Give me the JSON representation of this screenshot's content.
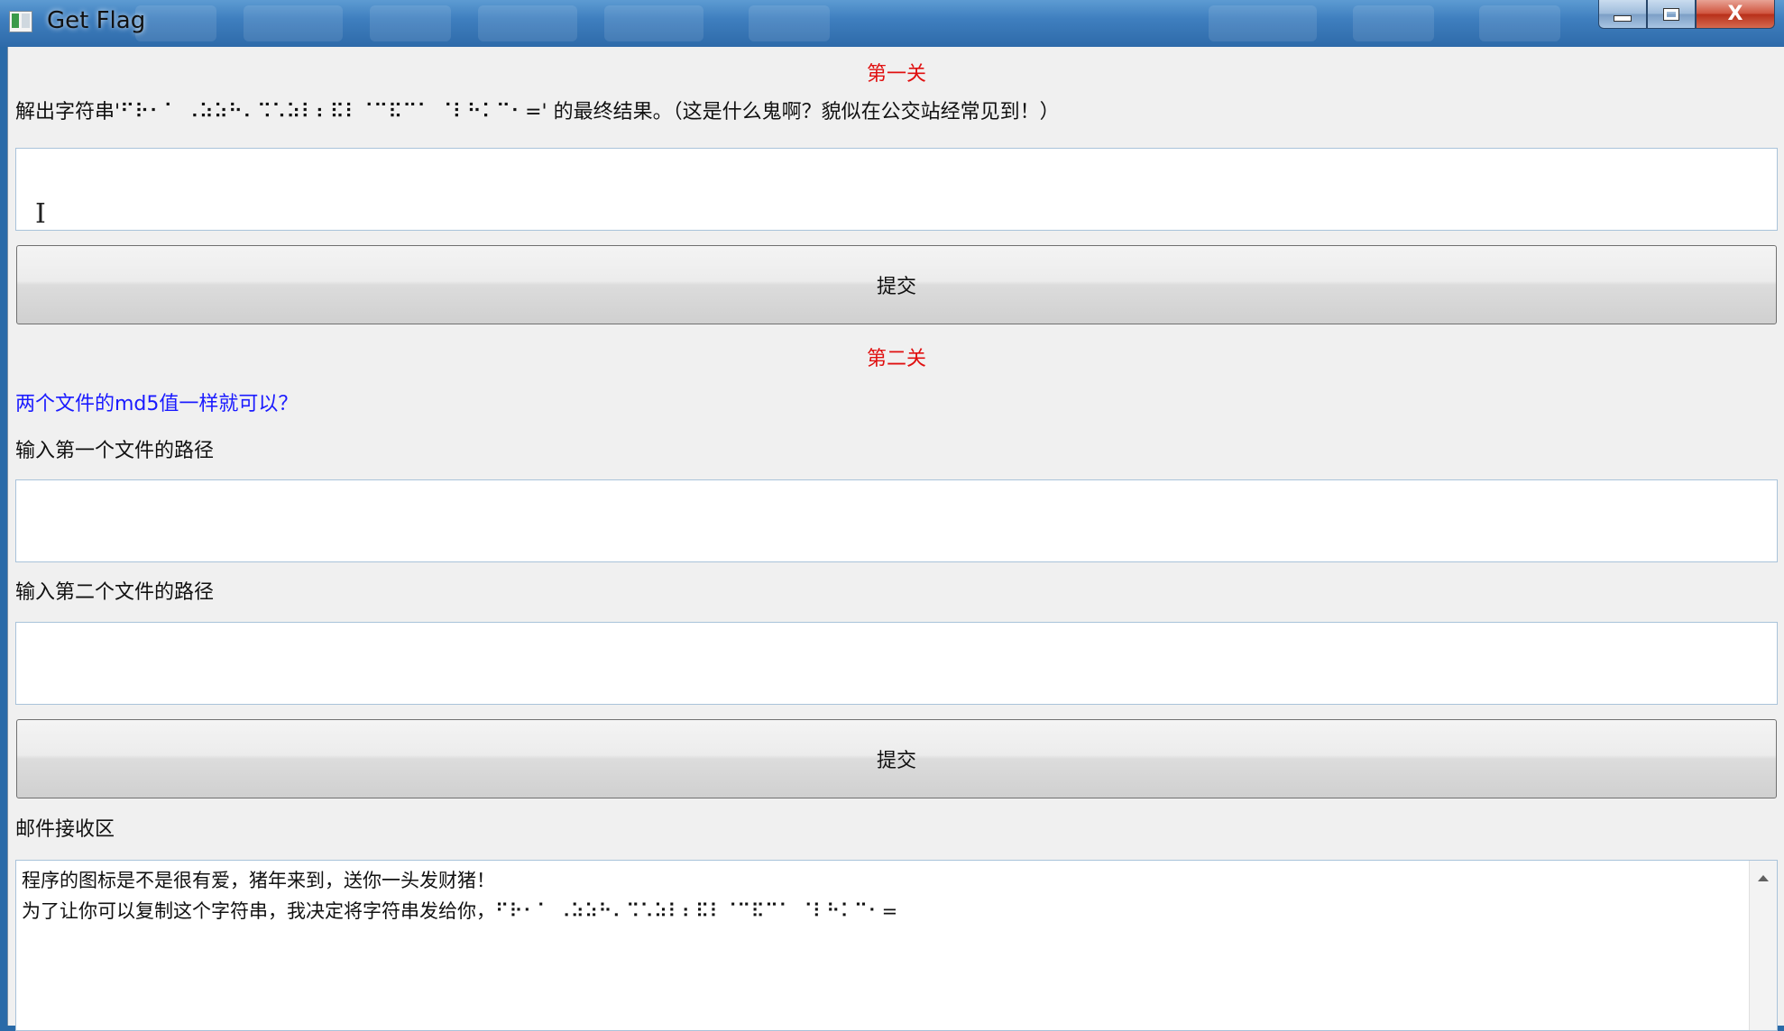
{
  "window": {
    "title": "Get Flag",
    "close_glyph": "X"
  },
  "level1": {
    "heading": "第一关",
    "prompt": "解出字符串'⠋⠗⠂⠁ ⠠⠵⠵⠓⠄⠩⠡⠵⠇⠆⠯⠇⠈⠉⠯⠉⠁ ⠈⠇⠓⠅⠉⠂=' 的最终结果。（这是什么鬼啊？貌似在公交站经常见到！）",
    "input_value": "",
    "submit_label": "提交"
  },
  "level2": {
    "heading": "第二关",
    "hint": "两个文件的md5值一样就可以？",
    "file1_label": "输入第一个文件的路径",
    "file1_value": "",
    "file2_label": "输入第二个文件的路径",
    "file2_value": "",
    "submit_label": "提交"
  },
  "mail": {
    "label": "邮件接收区",
    "lines": [
      "程序的图标是不是很有爱，猪年来到，送你一头发财猪！",
      "为了让你可以复制这个字符串，我决定将字符串发给你，⠋⠗⠂⠁ ⠠⠵⠵⠓⠄⠩⠡⠵⠇⠆⠯⠇⠈⠉⠯⠉⠁ ⠈⠇⠓⠅⠉⠂="
    ]
  },
  "colors": {
    "heading": "#e01010",
    "hint": "#1a1aff"
  }
}
